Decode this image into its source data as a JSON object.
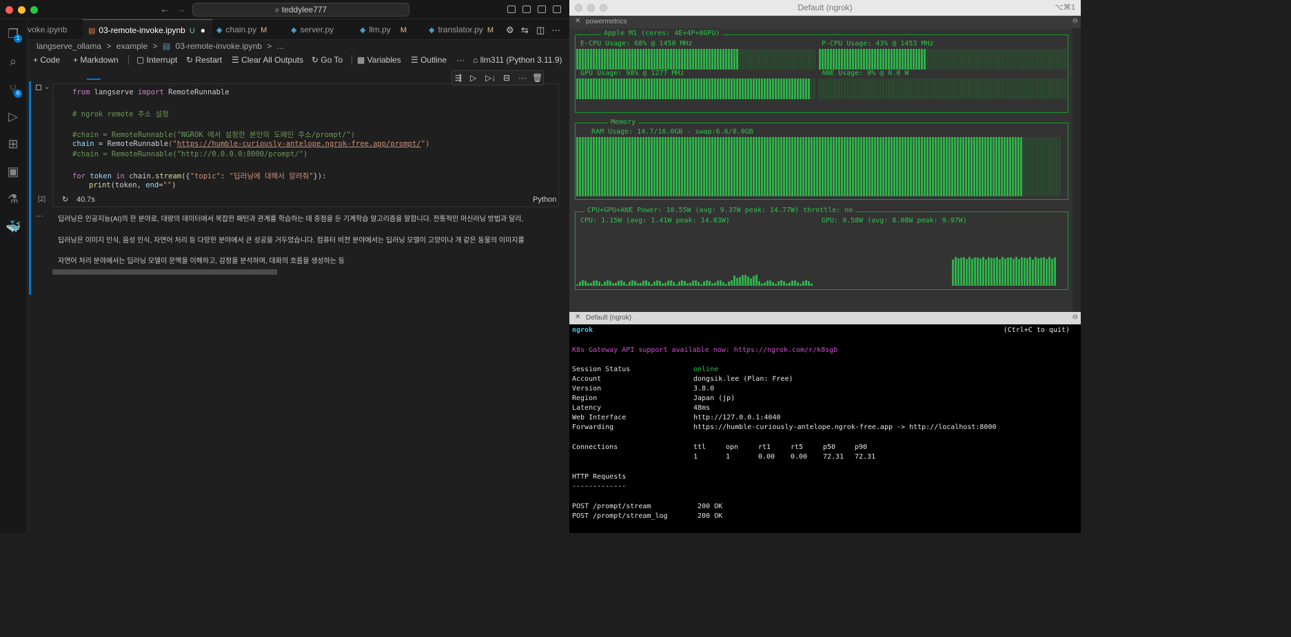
{
  "vscode": {
    "title": "teddylee777",
    "tabs": [
      {
        "label": "voke.ipynb",
        "mod": ""
      },
      {
        "label": "03-remote-invoke.ipynb",
        "mod": "U"
      },
      {
        "label": "chain.py",
        "mod": "M"
      },
      {
        "label": "server.py",
        "mod": ""
      },
      {
        "label": "llm.py",
        "mod": "M"
      },
      {
        "label": "translator.py",
        "mod": "M"
      }
    ],
    "activity_badges": [
      "1",
      "6"
    ],
    "breadcrumb": [
      "langserve_ollama",
      ">",
      "example",
      ">",
      "03-remote-invoke.ipynb",
      ">",
      "..."
    ],
    "toolbar": {
      "code": "Code",
      "markdown": "Markdown",
      "interrupt": "Interrupt",
      "restart": "Restart",
      "clear": "Clear All Outputs",
      "goto": "Go To",
      "variables": "Variables",
      "outline": "Outline",
      "more": "···",
      "kernel": "llm311 (Python 3.11.9)"
    },
    "cell": {
      "exec_count": "[2]",
      "exec_time": "40.7s",
      "language": "Python",
      "code": {
        "l1_kw": "from",
        "l1_mod": " langserve ",
        "l1_kw2": "import",
        "l1_cls": " RemoteRunnable",
        "l2": "# ngrok remote 주소 설정",
        "l3": "#chain = RemoteRunnable(\"NGROK 에서 설정한 본인의 도메인 주소/prompt/\")",
        "l4_a": "chain",
        "l4_b": " = ",
        "l4_c": "RemoteRunnable",
        "l4_d": "(\"",
        "l4_url": "https://humble-curiously-antelope.ngrok-free.app/prompt/",
        "l4_e": "\")",
        "l5": "#chain = RemoteRunnable(\"http://0.0.0.0:8000/prompt/\")",
        "l6_for": "for",
        "l6_a": " token ",
        "l6_in": "in",
        "l6_b": " chain.",
        "l6_fn": "stream",
        "l6_c": "({",
        "l6_str1": "\"topic\"",
        "l6_d": ": ",
        "l6_str2": "\"딥러닝에 대해서 알려줘\"",
        "l6_e": "}):",
        "l7_fn": "print",
        "l7_a": "(token, ",
        "l7_b": "end",
        "l7_c": "=",
        "l7_str": "\"\"",
        "l7_d": ")"
      }
    },
    "output": [
      "딥러닝은 인공지능(AI)의 한 분야로, 대량의 데이터에서 복잡한 패턴과 관계를 학습하는 데 중점을 둔 기계학습 알고리즘을 말합니다. 전통적인 머신러닝 방법과 달리,",
      "딥러닝은 이미지 인식, 음성 인식, 자연어 처리 등 다양한 분야에서 큰 성공을 거두었습니다. 컴퓨터 비전 분야에서는 딥러닝 모델이 고양이나 개 같은 동물의 이미지를",
      "자연어 처리 분야에서는 딥러닝 모델이 문맥을 이해하고, 감정을 분석하며, 대화의 흐름을 생성하는 등"
    ],
    "output_more": "···"
  },
  "powermetrics": {
    "window_title": "Default (ngrok)",
    "shortcut": "⌥⌘1",
    "tab": "powermetrics",
    "cpu_title": "Apple M1 (cores: 4E+4P+8GPU)",
    "ecpu": "E-CPU Usage: 68% @ 1450 MHz",
    "pcpu": "P-CPU Usage: 43% @ 1453 MHz",
    "gpu": "GPU Usage: 98% @ 1277 MHz",
    "ane": "ANE Usage: 0% @ 0.0 W",
    "ecpu_level": 0.68,
    "pcpu_level": 0.43,
    "gpu_level": 0.98,
    "mem_title": "Memory",
    "ram": "RAM Usage: 14.7/16.0GB - swap:6.6/8.0GB",
    "ram_level": 0.92,
    "power_title": "CPU+GPU+ANE Power: 10.55W (avg: 9.37W peak: 14.77W) throttle: no",
    "cpu_power": "CPU: 1.15W (avg: 1.41W peak: 14.83W)",
    "gpu_power": "GPU: 9.58W (avg: 8.08W peak: 9.97W)"
  },
  "ngrok": {
    "tab": "Default (ngrok)",
    "brand": "ngrok",
    "quit": "(Ctrl+C to quit)",
    "banner": "K8s Gateway API support available now: https://ngrok.com/r/k8sgb",
    "fields": [
      {
        "k": "Session Status",
        "v": "online"
      },
      {
        "k": "Account",
        "v": "dongsik.lee (Plan: Free)"
      },
      {
        "k": "Version",
        "v": "3.8.0"
      },
      {
        "k": "Region",
        "v": "Japan (jp)"
      },
      {
        "k": "Latency",
        "v": "48ms"
      },
      {
        "k": "Web Interface",
        "v": "http://127.0.0.1:4040"
      },
      {
        "k": "Forwarding",
        "v": "https://humble-curiously-antelope.ngrok-free.app -> http://localhost:8000"
      }
    ],
    "connections_label": "Connections",
    "conn_headers": [
      "ttl",
      "opn",
      "rt1",
      "rt5",
      "p50",
      "p90"
    ],
    "conn_values": [
      "1",
      "1",
      "0.00",
      "0.00",
      "72.31",
      "72.31"
    ],
    "http_title": "HTTP Requests",
    "http_rule": "-------------",
    "requests": [
      {
        "path": "POST /prompt/stream",
        "status": "200 OK"
      },
      {
        "path": "POST /prompt/stream_log",
        "status": "200 OK"
      }
    ],
    "colors": {
      "online": "#2ec44a",
      "brand": "#3ad0f0",
      "banner": "#d24fd2"
    }
  }
}
